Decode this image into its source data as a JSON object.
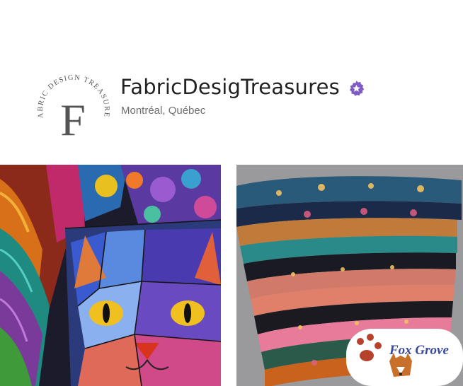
{
  "shop": {
    "name": "FabricDesigTreasures",
    "location": "Montréal, Québec",
    "logo_arc_text": "FABRIC DESIGN TREASURES",
    "logo_letter": "F",
    "badge_icon": "star-seller-icon",
    "badge_color": "#7f5cc4"
  },
  "gallery": {
    "left_image": "stained-glass-cat-fabric-panel",
    "right_image": "folded-fabric-stack",
    "right_watermark": "Fox Grove"
  },
  "colors": {
    "shop_name": "#222222",
    "location": "#6e6e6e",
    "logo": "#5a5a5a"
  }
}
